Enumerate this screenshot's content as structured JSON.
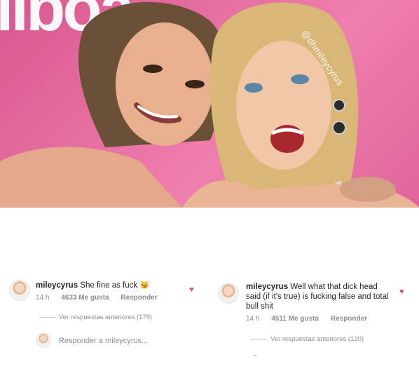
{
  "photo": {
    "backdrop_text": "llboa",
    "watermark": "@dhmileycyrus"
  },
  "comments": [
    {
      "username": "mileycyrus",
      "text": "She  fine as fuck",
      "emoji": "😼",
      "time": "14 h",
      "likes": "4633 Me gusta",
      "reply_label": "Responder",
      "view_replies": "Ver respuestas anteriores (179)",
      "reply_prompt": "Responder a mileycyrus..."
    },
    {
      "username": "mileycyrus",
      "text": "Well what that dick head said (if it's true) is fucking false and total bull shit",
      "time": "14 h",
      "likes": "4511 Me gusta",
      "reply_label": "Responder",
      "view_replies": "Ver respuestas anteriores (120)"
    }
  ],
  "colors": {
    "heart": "#ed4956",
    "pink_backdrop": "#e66ea1"
  },
  "icons": {
    "heart": "heart-icon",
    "avatar": "avatar"
  }
}
